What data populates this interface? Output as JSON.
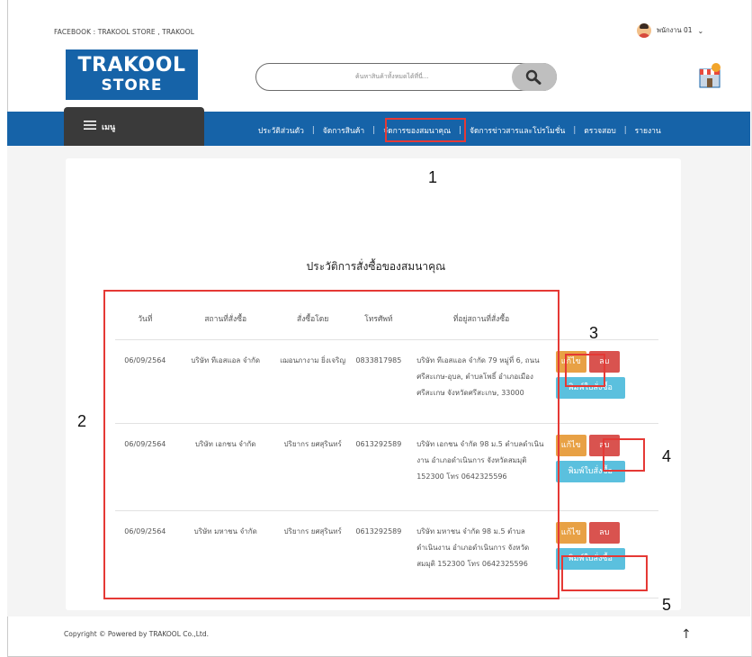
{
  "header": {
    "social_text": "FACEBOOK : TRAKOOL STORE , TRAKOOL",
    "user_name": "พนักงาน 01",
    "user_chevron": "⌄",
    "logo_line1": "TRAKOOL",
    "logo_line2": "STORE",
    "search_placeholder": "ค้นหาสินค้าทั้งหมดได้ที่นี่...",
    "search_icon": "search-icon"
  },
  "nav": {
    "menu_label": "เมนู",
    "items": [
      {
        "label": "ประวัติส่วนตัว"
      },
      {
        "label": "จัดการสินค้า"
      },
      {
        "label": "จัดการของสมนาคุณ"
      },
      {
        "label": "จัดการข่าวสารและโปรโมชั่น"
      },
      {
        "label": "ตรวจสอบ"
      },
      {
        "label": "รายงาน"
      }
    ]
  },
  "main": {
    "title": "ประวัติการสั่งซื้อของสมนาคุณ",
    "columns": [
      "วันที่",
      "สถานที่สั่งซื้อ",
      "สั่งซื้อโดย",
      "โทรศัพท์",
      "ที่อยู่สถานที่สั่งซื้อ"
    ],
    "actions": {
      "edit": "แก้ไข",
      "delete": "ลบ",
      "print": "พิมพ์ใบสั่งซื้อ"
    },
    "rows": [
      {
        "date": "06/09/2564",
        "site": "บริษัท ทีเอสแอล จำกัด",
        "by": "เฌอนภางาม ยิ่งเจริญ",
        "tel": "0833817985",
        "addr": "บริษัท ทีเอสแอล จำกัด 79 หมู่ที่ 6, ถนนศรีสะเกษ-อุบล, ตำบลโพธิ์ อำเภอเมืองศรีสะเกษ จังหวัดศรีสะเกษ, 33000"
      },
      {
        "date": "06/09/2564",
        "site": "บริษัท เอกชน จำกัด",
        "by": "ปริยากร ยศสุรินทร์",
        "tel": "0613292589",
        "addr": "บริษัท เอกชน จำกัด 98 ม.5 ตำบลดำเนินงาน อำเภอดำเนินการ จังหวัดสมมุติ 152300 โทร 0642325596"
      },
      {
        "date": "06/09/2564",
        "site": "บริษัท มหาชน จำกัด",
        "by": "ปริยากร ยศสุรินทร์",
        "tel": "0613292589",
        "addr": "บริษัท มหาชน จำกัด 98 ม.5 ตำบลดำเนินงาน อำเภอดำเนินการ จังหวัดสมมุติ 152300 โทร 0642325596"
      }
    ]
  },
  "callouts": [
    "1",
    "2",
    "3",
    "4",
    "5"
  ],
  "footer": {
    "copyright": "Copyright © Powered by TRAKOOL Co.,Ltd.",
    "up_arrow": "↑"
  },
  "colors": {
    "brand_blue": "#1663a8",
    "menu_dark": "#3a3a3a",
    "edit_orange": "#e8a145",
    "delete_red": "#d9534f",
    "print_cyan": "#5bc0de",
    "annotation_red": "#e53935"
  }
}
